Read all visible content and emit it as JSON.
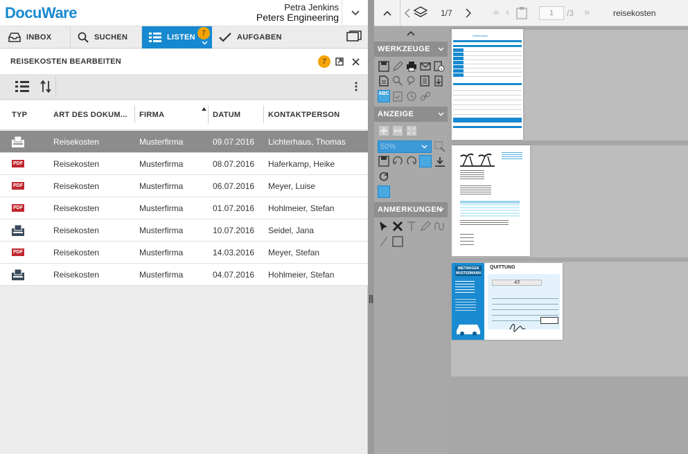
{
  "app": {
    "logo": "DocuWare"
  },
  "user": {
    "name": "Petra Jenkins",
    "company": "Peters Engineering"
  },
  "nav": {
    "tabs": [
      {
        "label": "INBOX",
        "icon": "inbox-icon"
      },
      {
        "label": "SUCHEN",
        "icon": "search-icon"
      },
      {
        "label": "LISTEN",
        "icon": "list-icon",
        "badge": "7",
        "active": true
      },
      {
        "label": "AUFGABEN",
        "icon": "check-icon"
      }
    ]
  },
  "panel": {
    "title": "REISEKOSTEN BEARBEITEN",
    "badge": "7"
  },
  "table": {
    "columns": [
      "TYP",
      "ART DES DOKUM...",
      "FIRMA",
      "DATUM",
      "KONTAKTPERSON"
    ],
    "rows": [
      {
        "type": "tray",
        "art": "Reisekosten",
        "firma": "Musterfirma",
        "datum": "09.07.2016",
        "kontakt": "Lichterhaus, Thomas",
        "selected": true
      },
      {
        "type": "pdf",
        "art": "Reisekosten",
        "firma": "Musterfirma",
        "datum": "08.07.2016",
        "kontakt": "Haferkamp, Heike"
      },
      {
        "type": "pdf",
        "art": "Reisekosten",
        "firma": "Musterfirma",
        "datum": "06.07.2016",
        "kontakt": "Meyer, Luise"
      },
      {
        "type": "pdf",
        "art": "Reisekosten",
        "firma": "Musterfirma",
        "datum": "01.07.2016",
        "kontakt": "Hohlmeier, Stefan"
      },
      {
        "type": "tray",
        "art": "Reisekosten",
        "firma": "Musterfirma",
        "datum": "10.07.2016",
        "kontakt": "Seidel, Jana"
      },
      {
        "type": "pdf",
        "art": "Reisekosten",
        "firma": "Musterfirma",
        "datum": "14.03.2016",
        "kontakt": "Meyer, Stefan"
      },
      {
        "type": "tray",
        "art": "Reisekosten",
        "firma": "Musterfirma",
        "datum": "04.07.2016",
        "kontakt": "Hohlmeier, Stefan"
      }
    ],
    "pdf_label": "PDF"
  },
  "viewer": {
    "page_indicator": "1/7",
    "page_input": "1",
    "page_total": "/3",
    "doc_title": "reisekosten",
    "zoom": "50%",
    "sections": {
      "tools": "WERKZEUGE",
      "display": "ANZEIGE",
      "annotations": "ANMERKUNGEN"
    }
  },
  "thumbs": {
    "receipt_title": "QUITTUNG",
    "receipt_brand_1": "MIETWAGEN",
    "receipt_brand_2": "MUSTERMANN",
    "receipt_amount": "43",
    "form_title": "Reisekosten"
  },
  "colors": {
    "accent": "#1789d0",
    "badge": "#f5a300",
    "pdf": "#c0272d",
    "selected_row": "#8c8c8c"
  }
}
